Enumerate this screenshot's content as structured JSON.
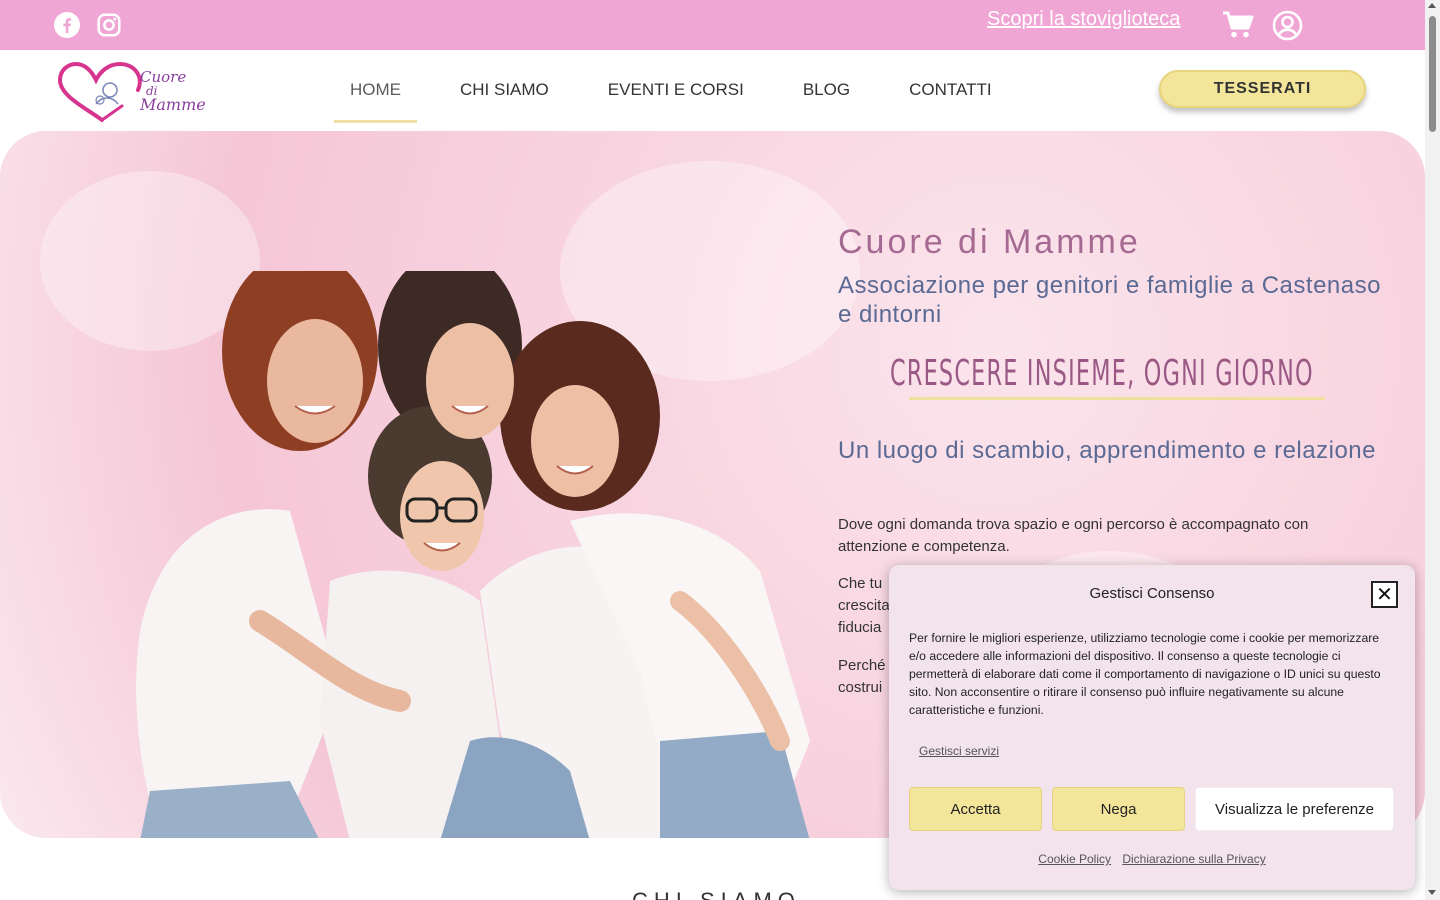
{
  "topbar": {
    "stovi_link": "Scopri la stoviglioteca",
    "icons": [
      "facebook-icon",
      "instagram-icon",
      "cart-icon",
      "user-icon"
    ],
    "bg_color": "#f0a6d4"
  },
  "header": {
    "logo": {
      "line1": "Cuore",
      "line2": "di",
      "line3": "Mamme"
    },
    "nav": [
      {
        "label": "HOME",
        "active": true
      },
      {
        "label": "CHI SIAMO",
        "active": false
      },
      {
        "label": "EVENTI E CORSI",
        "active": false
      },
      {
        "label": "BLOG",
        "active": false
      },
      {
        "label": "CONTATTI",
        "active": false
      }
    ],
    "cta": "TESSERATI"
  },
  "hero": {
    "title": "Cuore di Mamme",
    "subtitle": "Associazione per genitori e famiglie a Castenaso e dintorni",
    "tagline": "CRESCERE INSIEME, OGNI GIORNO",
    "heading": "Un luogo di scambio, apprendimento e relazione",
    "p1": "Dove ogni domanda trova spazio e ogni percorso è accompagnato con attenzione e competenza.",
    "p2_lines": [
      "Che tu",
      "crescita",
      "fiducia"
    ],
    "p3_lines": [
      "Perché",
      "costrui"
    ]
  },
  "below_section_title": "CHI SIAMO",
  "cookie": {
    "title": "Gestisci Consenso",
    "body": "Per fornire le migliori esperienze, utilizziamo tecnologie come i cookie per memorizzare e/o accedere alle informazioni del dispositivo. Il consenso a queste tecnologie ci permetterà di elaborare dati come il comportamento di navigazione o ID unici su questo sito. Non acconsentire o ritirare il consenso può influire negativamente su alcune caratteristiche e funzioni.",
    "manage_services": "Gestisci servizi",
    "accept": "Accetta",
    "deny": "Nega",
    "preferences": "Visualizza le preferenze",
    "cookie_policy": "Cookie Policy",
    "privacy": "Dichiarazione sulla Privacy",
    "close_symbol": "✕"
  }
}
